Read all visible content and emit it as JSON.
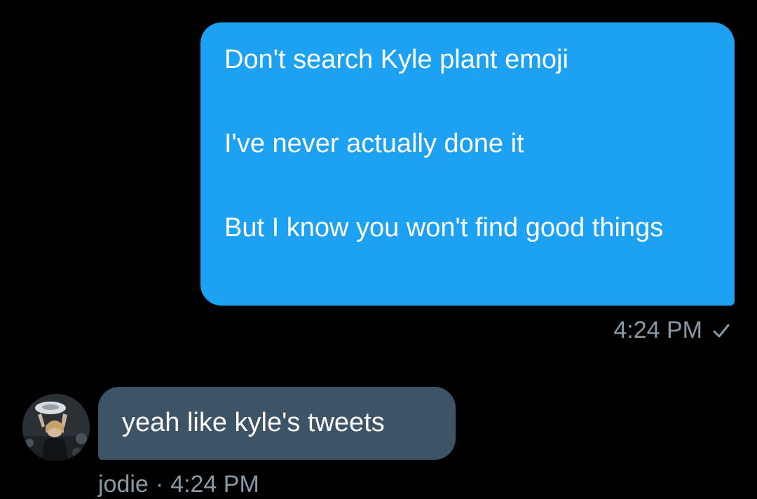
{
  "conversation": {
    "sent_message": {
      "paragraphs": [
        "Don't search Kyle plant emoji",
        "I've never actually done it",
        "But I know you won't find good things"
      ],
      "time": "4:24 PM",
      "status_icon": "checkmark-icon"
    },
    "received_message": {
      "text": "yeah like kyle's tweets",
      "sender": "jodie",
      "separator": "·",
      "time": "4:24 PM",
      "avatar_icon": "avatar-photo"
    }
  },
  "colors": {
    "background": "#000000",
    "sent_bubble": "#1da1f2",
    "received_bubble": "#3d5466",
    "meta_text": "#8899a6"
  }
}
